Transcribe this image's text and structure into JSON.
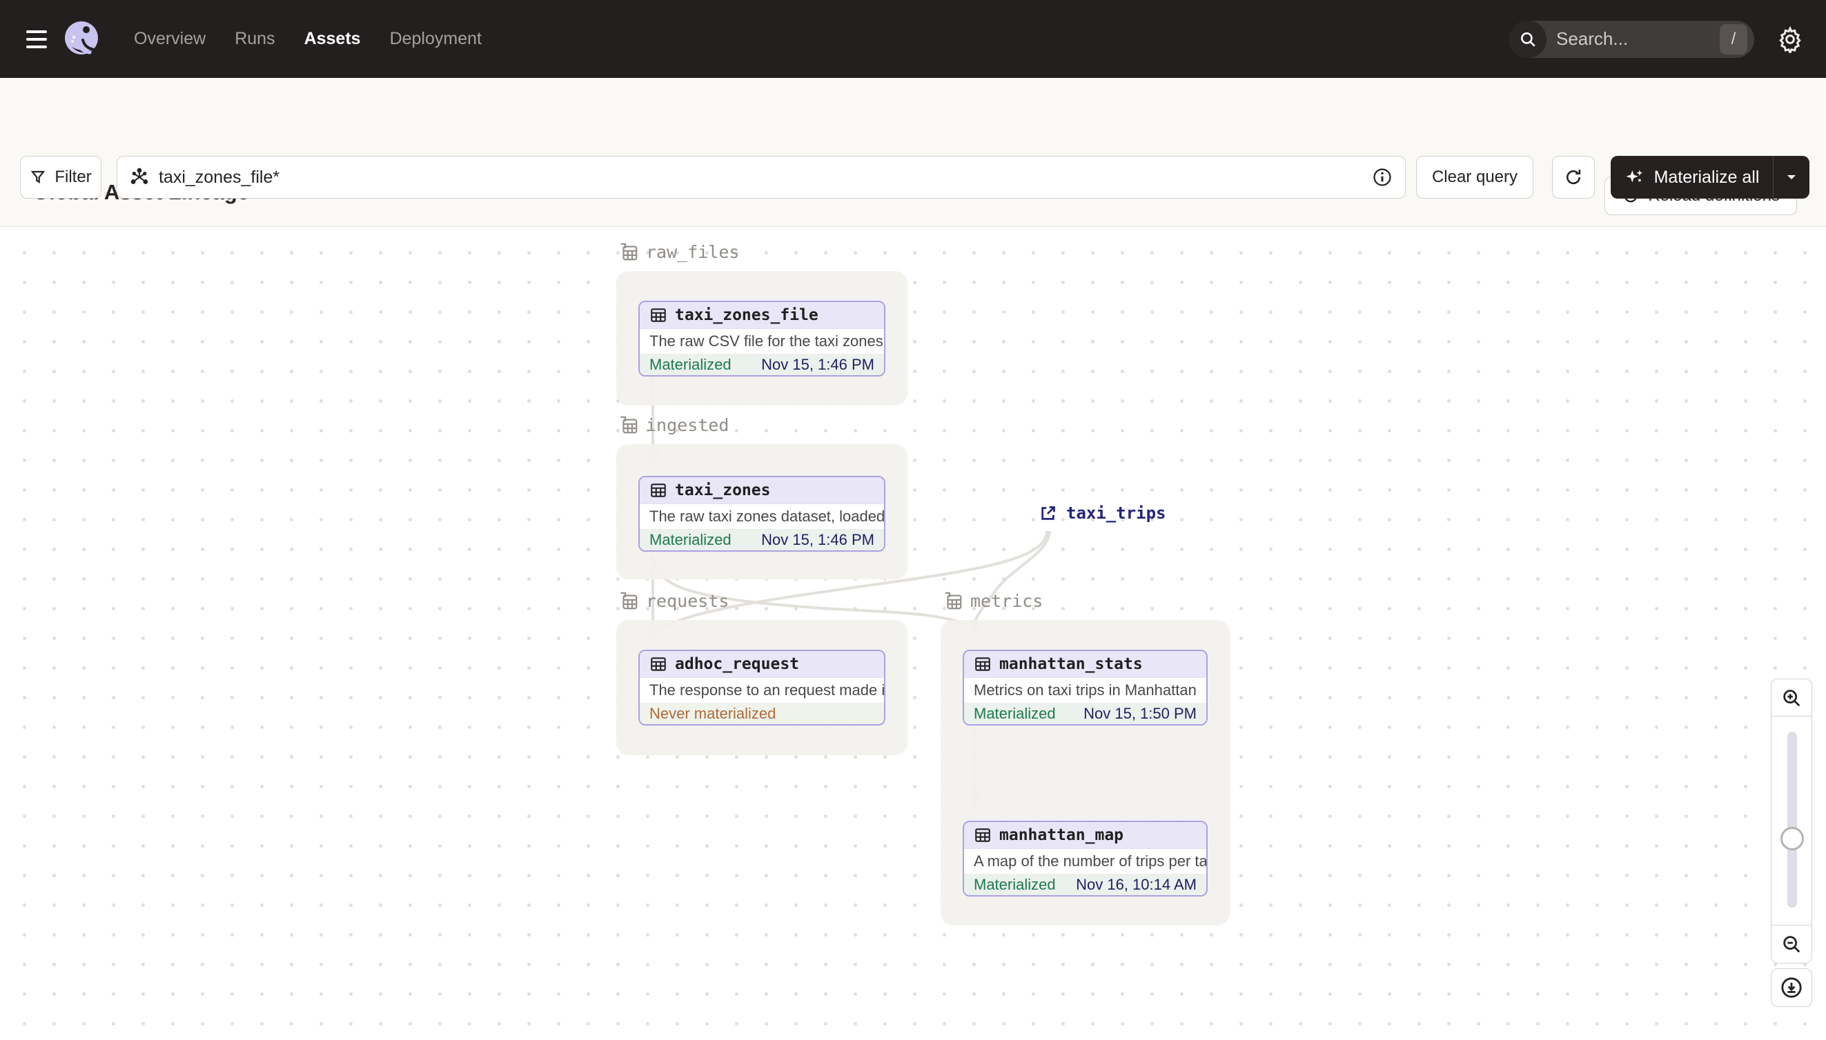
{
  "nav": {
    "items": [
      {
        "label": "Overview",
        "active": false
      },
      {
        "label": "Runs",
        "active": false
      },
      {
        "label": "Assets",
        "active": true
      },
      {
        "label": "Deployment",
        "active": false
      }
    ],
    "search": {
      "placeholder": "Search...",
      "shortcut": "/"
    }
  },
  "header": {
    "title": "Global Asset Lineage",
    "reload_label": "Reload definitions"
  },
  "toolbar": {
    "filter_label": "Filter",
    "query_value": "taxi_zones_file*",
    "clear_label": "Clear query",
    "materialize_label": "Materialize all"
  },
  "graph": {
    "groups": [
      {
        "name": "raw_files"
      },
      {
        "name": "ingested"
      },
      {
        "name": "requests"
      },
      {
        "name": "metrics"
      }
    ],
    "nodes": [
      {
        "name": "taxi_zones_file",
        "description": "The raw CSV file for the taxi zones dat...",
        "status": "Materialized",
        "timestamp": "Nov 15, 1:46 PM",
        "group": "raw_files"
      },
      {
        "name": "taxi_zones",
        "description": "The raw taxi zones dataset, loaded int...",
        "status": "Materialized",
        "timestamp": "Nov 15, 1:46 PM",
        "group": "ingested"
      },
      {
        "name": "adhoc_request",
        "description": "The response to an request made in th...",
        "status": "Never materialized",
        "timestamp": "",
        "group": "requests"
      },
      {
        "name": "manhattan_stats",
        "description": "Metrics on taxi trips in Manhattan",
        "status": "Materialized",
        "timestamp": "Nov 15, 1:50 PM",
        "group": "metrics"
      },
      {
        "name": "manhattan_map",
        "description": "A map of the number of trips per taxi z...",
        "status": "Materialized",
        "timestamp": "Nov 16, 10:14 AM",
        "group": "metrics"
      }
    ],
    "external_asset": {
      "name": "taxi_trips"
    },
    "edges": [
      {
        "from": "taxi_zones_file",
        "to": "taxi_zones"
      },
      {
        "from": "taxi_zones",
        "to": "adhoc_request"
      },
      {
        "from": "taxi_zones",
        "to": "manhattan_stats"
      },
      {
        "from": "taxi_trips",
        "to": "adhoc_request"
      },
      {
        "from": "taxi_trips",
        "to": "manhattan_stats"
      },
      {
        "from": "manhattan_stats",
        "to": "manhattan_map"
      }
    ]
  },
  "colors": {
    "nav_bg": "#231F1F",
    "accent_purple": "#ABA1E1",
    "node_header_bg": "#E9E6F8",
    "materialized_green": "#1C7A4D",
    "never_materialized_orange": "#AF6B35",
    "timestamp_navy": "#1D2264",
    "edge_gray": "#E3E0DC",
    "dark_button_bg": "#262120"
  }
}
